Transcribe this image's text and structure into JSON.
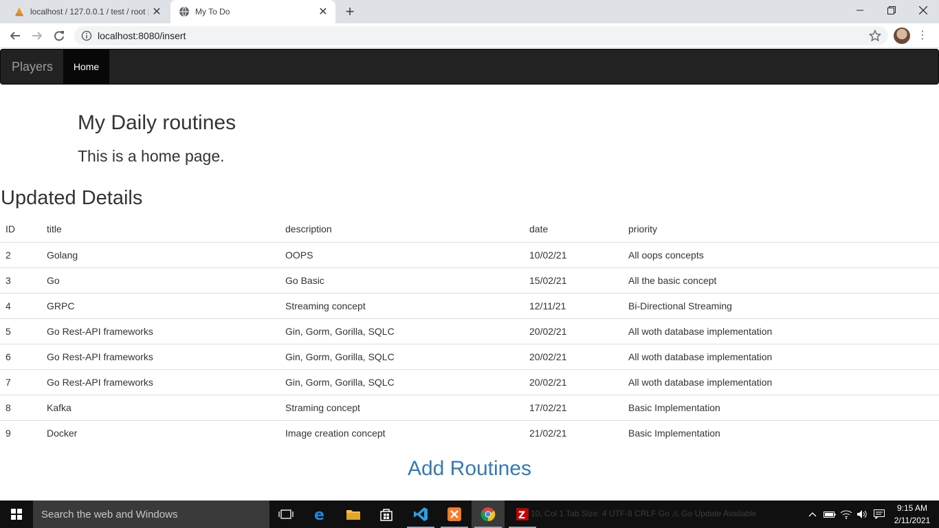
{
  "browser": {
    "tabs": [
      {
        "title": "localhost / 127.0.0.1 / test / root |",
        "active": false
      },
      {
        "title": "My To Do",
        "active": true
      }
    ],
    "url": "localhost:8080/insert"
  },
  "navbar": {
    "brand": "Players",
    "items": [
      {
        "label": "Home",
        "active": true
      }
    ]
  },
  "page": {
    "title": "My Daily routines",
    "subtitle": "This is a home page.",
    "section_title": "Updated Details",
    "add_link": "Add Routines"
  },
  "table": {
    "columns": [
      "ID",
      "title",
      "description",
      "date",
      "priority"
    ],
    "rows": [
      [
        "2",
        "Golang",
        "OOPS",
        "10/02/21",
        "All oops concepts"
      ],
      [
        "3",
        "Go",
        "Go Basic",
        "15/02/21",
        "All the basic concept"
      ],
      [
        "4",
        "GRPC",
        "Streaming concept",
        "12/11/21",
        "Bi-Directional Streaming"
      ],
      [
        "5",
        "Go Rest-API frameworks",
        "Gin, Gorm, Gorilla, SQLC",
        "20/02/21",
        "All woth database implementation"
      ],
      [
        "6",
        "Go Rest-API frameworks",
        "Gin, Gorm, Gorilla, SQLC",
        "20/02/21",
        "All woth database implementation"
      ],
      [
        "7",
        "Go Rest-API frameworks",
        "Gin, Gorm, Gorilla, SQLC",
        "20/02/21",
        "All woth database implementation"
      ],
      [
        "8",
        "Kafka",
        "Straming concept",
        "17/02/21",
        "Basic Implementation"
      ],
      [
        "9",
        "Docker",
        "Image creation concept",
        "21/02/21",
        "Basic Implementation"
      ]
    ]
  },
  "taskbar": {
    "search_placeholder": "Search the web and Windows",
    "background_status": "10, Col 1    Tab Size: 4    UTF-8    CRLF    Go    ⚠ Go Update Available",
    "time": "9:15 AM",
    "date": "2/11/2021",
    "apps": [
      "task-view-icon",
      "edge-icon",
      "file-explorer-icon",
      "store-icon",
      "vscode-icon",
      "xampp-icon",
      "chrome-icon",
      "filezilla-icon"
    ]
  },
  "colors": {
    "navbar_bg": "#222222",
    "link": "#337ab7",
    "tabstrip": "#dee1e6",
    "taskbar": "#101010"
  }
}
